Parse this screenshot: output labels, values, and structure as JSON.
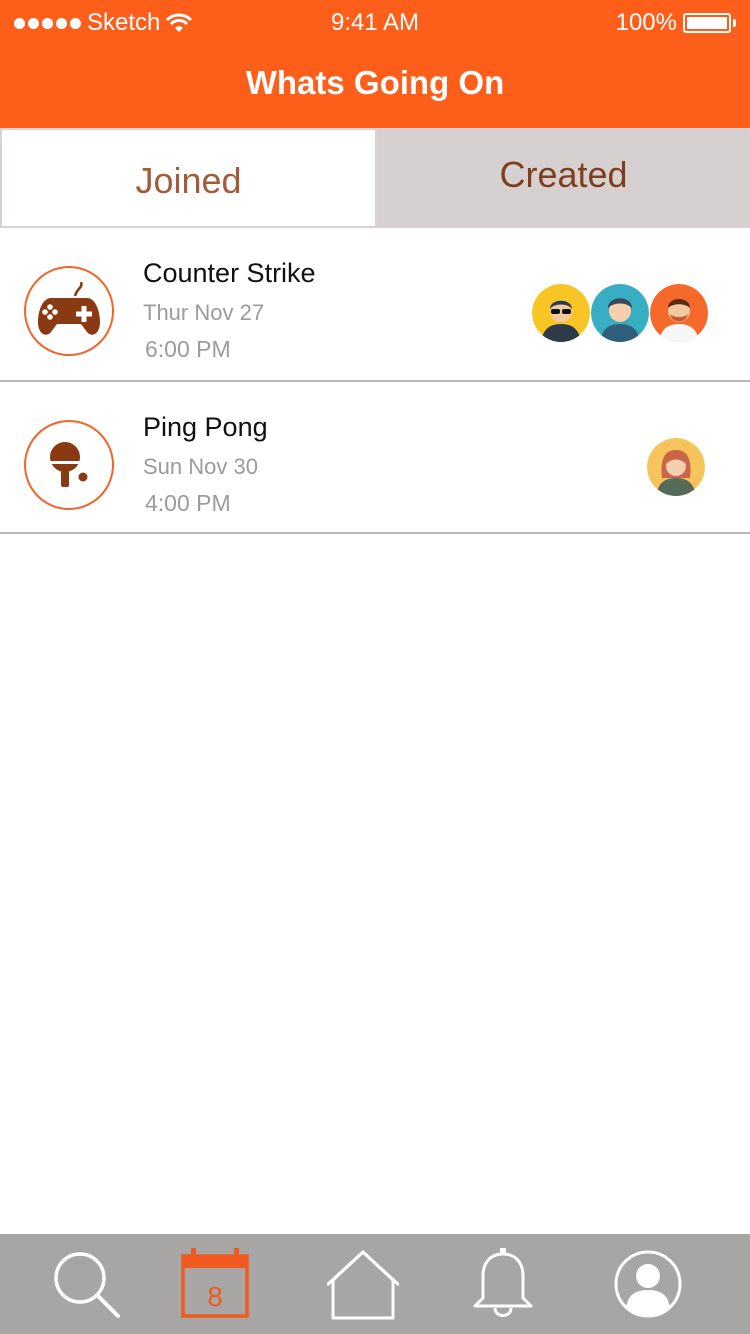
{
  "status_bar": {
    "carrier": "Sketch",
    "time": "9:41 AM",
    "battery": "100%"
  },
  "header": {
    "title": "Whats Going On"
  },
  "tabs": [
    {
      "label": "Joined",
      "active": true
    },
    {
      "label": "Created",
      "active": false
    }
  ],
  "events": [
    {
      "name": "Counter Strike",
      "date": "Thur  Nov 27",
      "time": "6:00 PM",
      "icon": "gamepad-icon",
      "attendees": [
        "avatar-sunglasses",
        "avatar-man",
        "avatar-bearded-man"
      ]
    },
    {
      "name": "Ping Pong",
      "date": "Sun  Nov 30",
      "time": "4:00 PM",
      "icon": "ping-pong-icon",
      "attendees": [
        "avatar-woman"
      ]
    }
  ],
  "tab_bar": {
    "items": [
      "search-icon",
      "calendar-icon",
      "home-icon",
      "bell-icon",
      "profile-icon"
    ],
    "calendar_day": "8",
    "active": "calendar-icon"
  },
  "colors": {
    "accent": "#fd5f1b",
    "icon_brown": "#8a3a12",
    "tab_bar": "#a7a6a5",
    "created_tab": "#d7d0d0"
  }
}
